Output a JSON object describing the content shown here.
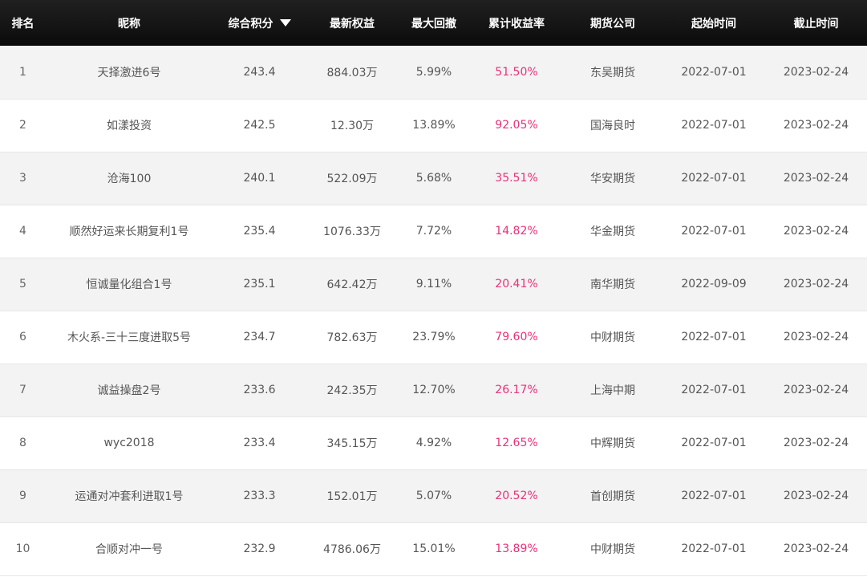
{
  "columns": {
    "rank": "排名",
    "name": "昵称",
    "score": "综合积分",
    "equity": "最新权益",
    "drawdown": "最大回撤",
    "return": "累计收益率",
    "company": "期货公司",
    "start": "起始时间",
    "end": "截止时间"
  },
  "sort": {
    "column": "score",
    "direction": "desc",
    "icon": "sort-desc-triangle-icon"
  },
  "colors": {
    "header_bg": "#141414",
    "header_text": "#ffffff",
    "row_alt_bg": "#f3f3f3",
    "text": "#555555",
    "return_color": "#e8317a"
  },
  "rows": [
    {
      "rank": "1",
      "name": "天择激进6号",
      "score": "243.4",
      "equity": "884.03万",
      "drawdown": "5.99%",
      "return": "51.50%",
      "company": "东吴期货",
      "start": "2022-07-01",
      "end": "2023-02-24"
    },
    {
      "rank": "2",
      "name": "如漾投资",
      "score": "242.5",
      "equity": "12.30万",
      "drawdown": "13.89%",
      "return": "92.05%",
      "company": "国海良时",
      "start": "2022-07-01",
      "end": "2023-02-24"
    },
    {
      "rank": "3",
      "name": "沧海100",
      "score": "240.1",
      "equity": "522.09万",
      "drawdown": "5.68%",
      "return": "35.51%",
      "company": "华安期货",
      "start": "2022-07-01",
      "end": "2023-02-24"
    },
    {
      "rank": "4",
      "name": "顺然好运来长期复利1号",
      "score": "235.4",
      "equity": "1076.33万",
      "drawdown": "7.72%",
      "return": "14.82%",
      "company": "华金期货",
      "start": "2022-07-01",
      "end": "2023-02-24"
    },
    {
      "rank": "5",
      "name": "恒诚量化组合1号",
      "score": "235.1",
      "equity": "642.42万",
      "drawdown": "9.11%",
      "return": "20.41%",
      "company": "南华期货",
      "start": "2022-09-09",
      "end": "2023-02-24"
    },
    {
      "rank": "6",
      "name": "木火系-三十三度进取5号",
      "score": "234.7",
      "equity": "782.63万",
      "drawdown": "23.79%",
      "return": "79.60%",
      "company": "中财期货",
      "start": "2022-07-01",
      "end": "2023-02-24"
    },
    {
      "rank": "7",
      "name": "诚益操盘2号",
      "score": "233.6",
      "equity": "242.35万",
      "drawdown": "12.70%",
      "return": "26.17%",
      "company": "上海中期",
      "start": "2022-07-01",
      "end": "2023-02-24"
    },
    {
      "rank": "8",
      "name": "wyc2018",
      "score": "233.4",
      "equity": "345.15万",
      "drawdown": "4.92%",
      "return": "12.65%",
      "company": "中辉期货",
      "start": "2022-07-01",
      "end": "2023-02-24"
    },
    {
      "rank": "9",
      "name": "运通对冲套利进取1号",
      "score": "233.3",
      "equity": "152.01万",
      "drawdown": "5.07%",
      "return": "20.52%",
      "company": "首创期货",
      "start": "2022-07-01",
      "end": "2023-02-24"
    },
    {
      "rank": "10",
      "name": "合顺对冲一号",
      "score": "232.9",
      "equity": "4786.06万",
      "drawdown": "15.01%",
      "return": "13.89%",
      "company": "中财期货",
      "start": "2022-07-01",
      "end": "2023-02-24"
    }
  ]
}
